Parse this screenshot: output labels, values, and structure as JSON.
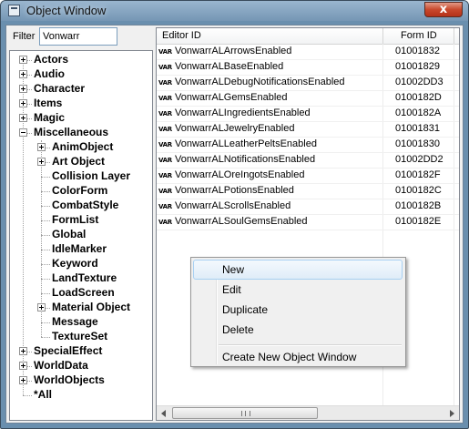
{
  "window": {
    "title": "Object Window",
    "close_glyph": "x",
    "icon": "app-window-icon"
  },
  "filter": {
    "label": "Filter",
    "value": "Vonwarr"
  },
  "tree": {
    "items": [
      {
        "label": "Actors",
        "expander": "+"
      },
      {
        "label": "Audio",
        "expander": "+"
      },
      {
        "label": "Character",
        "expander": "+"
      },
      {
        "label": "Items",
        "expander": "+"
      },
      {
        "label": "Magic",
        "expander": "+"
      },
      {
        "label": "Miscellaneous",
        "expander": "-"
      },
      {
        "label": "AnimObject",
        "expander": "+"
      },
      {
        "label": "Art Object",
        "expander": "+"
      },
      {
        "label": "Collision Layer",
        "expander": ""
      },
      {
        "label": "ColorForm",
        "expander": ""
      },
      {
        "label": "CombatStyle",
        "expander": ""
      },
      {
        "label": "FormList",
        "expander": ""
      },
      {
        "label": "Global",
        "expander": ""
      },
      {
        "label": "IdleMarker",
        "expander": ""
      },
      {
        "label": "Keyword",
        "expander": ""
      },
      {
        "label": "LandTexture",
        "expander": ""
      },
      {
        "label": "LoadScreen",
        "expander": ""
      },
      {
        "label": "Material Object",
        "expander": "+"
      },
      {
        "label": "Message",
        "expander": ""
      },
      {
        "label": "TextureSet",
        "expander": ""
      },
      {
        "label": "SpecialEffect",
        "expander": "+"
      },
      {
        "label": "WorldData",
        "expander": "+"
      },
      {
        "label": "WorldObjects",
        "expander": "+"
      },
      {
        "label": "*All",
        "expander": ""
      }
    ]
  },
  "list": {
    "columns": [
      "Editor ID",
      "Form ID"
    ],
    "row_icon_text": "VAR",
    "rows": [
      {
        "editor_id": "VonwarrALArrowsEnabled",
        "form_id": "01001832"
      },
      {
        "editor_id": "VonwarrALBaseEnabled",
        "form_id": "01001829"
      },
      {
        "editor_id": "VonwarrALDebugNotificationsEnabled",
        "form_id": "01002DD3"
      },
      {
        "editor_id": "VonwarrALGemsEnabled",
        "form_id": "0100182D"
      },
      {
        "editor_id": "VonwarrALIngredientsEnabled",
        "form_id": "0100182A"
      },
      {
        "editor_id": "VonwarrALJewelryEnabled",
        "form_id": "01001831"
      },
      {
        "editor_id": "VonwarrALLeatherPeltsEnabled",
        "form_id": "01001830"
      },
      {
        "editor_id": "VonwarrALNotificationsEnabled",
        "form_id": "01002DD2"
      },
      {
        "editor_id": "VonwarrALOreIngotsEnabled",
        "form_id": "0100182F"
      },
      {
        "editor_id": "VonwarrALPotionsEnabled",
        "form_id": "0100182C"
      },
      {
        "editor_id": "VonwarrALScrollsEnabled",
        "form_id": "0100182B"
      },
      {
        "editor_id": "VonwarrALSoulGemsEnabled",
        "form_id": "0100182E"
      }
    ]
  },
  "context_menu": {
    "items": [
      "New",
      "Edit",
      "Duplicate",
      "Delete",
      "Create New Object Window"
    ],
    "highlighted": "New"
  },
  "colors": {
    "title_bar": "#7596b4",
    "close_button": "#c8482c",
    "menu_highlight": "#dfecf8"
  }
}
